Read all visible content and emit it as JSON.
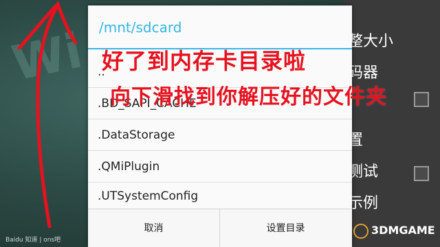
{
  "background": {
    "right_menu_items": [
      "整大小",
      "码器",
      "置",
      "测试",
      "示例"
    ]
  },
  "dialog": {
    "title": "/mnt/sdcard",
    "items": [
      "..",
      ".BD_SAPI_CACHE",
      ".DataStorage",
      ".QMiPlugin",
      ".UTSystemConfig"
    ],
    "buttons": {
      "cancel": "取消",
      "set_directory": "设置目录"
    }
  },
  "annotations": {
    "line1": "好了到内存卡目录啦",
    "line2": "向下滑找到你解压好的文件夹"
  },
  "watermarks": {
    "left": "Baidu 知道 | ons吧",
    "right": "3DMGAME"
  },
  "colors": {
    "accent": "#33b5e5",
    "annotation_red": "#e6121f"
  }
}
